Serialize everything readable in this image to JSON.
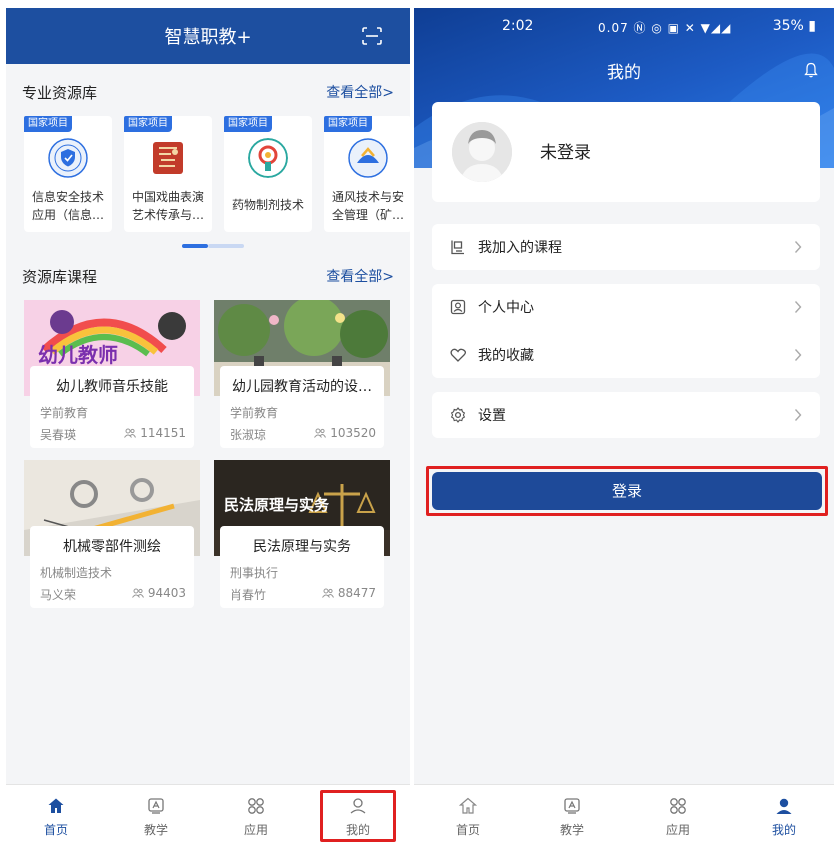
{
  "left": {
    "header_title": "智慧职教+",
    "resource_section": {
      "title": "专业资源库",
      "more": "查看全部>"
    },
    "resources": [
      {
        "tag": "国家项目",
        "name": "信息安全技术应用（信息…",
        "icon": "shield-seal-logo"
      },
      {
        "tag": "国家项目",
        "name": "中国戏曲表演艺术传承与…",
        "icon": "opera-mask-logo"
      },
      {
        "tag": "国家项目",
        "name": "药物制剂技术",
        "icon": "pharmacy-logo"
      },
      {
        "tag": "国家项目",
        "name": "通风技术与安全管理（矿…",
        "icon": "ventilation-logo"
      }
    ],
    "course_section": {
      "title": "资源库课程",
      "more": "查看全部>"
    },
    "courses": [
      {
        "name": "幼儿教师音乐技能",
        "category": "学前教育",
        "teacher": "吴春瑛",
        "views": "114151",
        "image_text": "幼儿教师\n音乐技能"
      },
      {
        "name": "幼儿园教育活动的设…",
        "category": "学前教育",
        "teacher": "张淑琼",
        "views": "103520",
        "image_text": ""
      },
      {
        "name": "机械零部件测绘",
        "category": "机械制造技术",
        "teacher": "马义荣",
        "views": "94403",
        "image_text": ""
      },
      {
        "name": "民法原理与实务",
        "category": "刑事执行",
        "teacher": "肖春竹",
        "views": "88477",
        "image_text": "民法原理与实务"
      }
    ],
    "tabs": [
      {
        "label": "首页",
        "icon": "home-icon"
      },
      {
        "label": "教学",
        "icon": "teaching-icon"
      },
      {
        "label": "应用",
        "icon": "apps-icon"
      },
      {
        "label": "我的",
        "icon": "user-icon"
      }
    ],
    "active_tab": "首页",
    "highlighted_tab": "我的"
  },
  "right": {
    "status": {
      "time": "2:02",
      "icons": "0.07 Ⓝ ◎ ▣ ✕ ▼◢◢",
      "battery": "35%"
    },
    "title": "我的",
    "profile": {
      "status": "未登录"
    },
    "menu_groups": [
      [
        {
          "label": "我加入的课程",
          "icon": "course-list-icon"
        }
      ],
      [
        {
          "label": "个人中心",
          "icon": "person-card-icon"
        },
        {
          "label": "我的收藏",
          "icon": "heart-icon"
        }
      ],
      [
        {
          "label": "设置",
          "icon": "gear-icon"
        }
      ]
    ],
    "login_button": "登录",
    "tabs": [
      {
        "label": "首页",
        "icon": "home-icon"
      },
      {
        "label": "教学",
        "icon": "teaching-icon"
      },
      {
        "label": "应用",
        "icon": "apps-icon"
      },
      {
        "label": "我的",
        "icon": "user-icon"
      }
    ],
    "active_tab": "我的"
  },
  "colors": {
    "brand": "#1d4fa0",
    "highlight": "#e02020",
    "tag": "#2d6fe0"
  }
}
